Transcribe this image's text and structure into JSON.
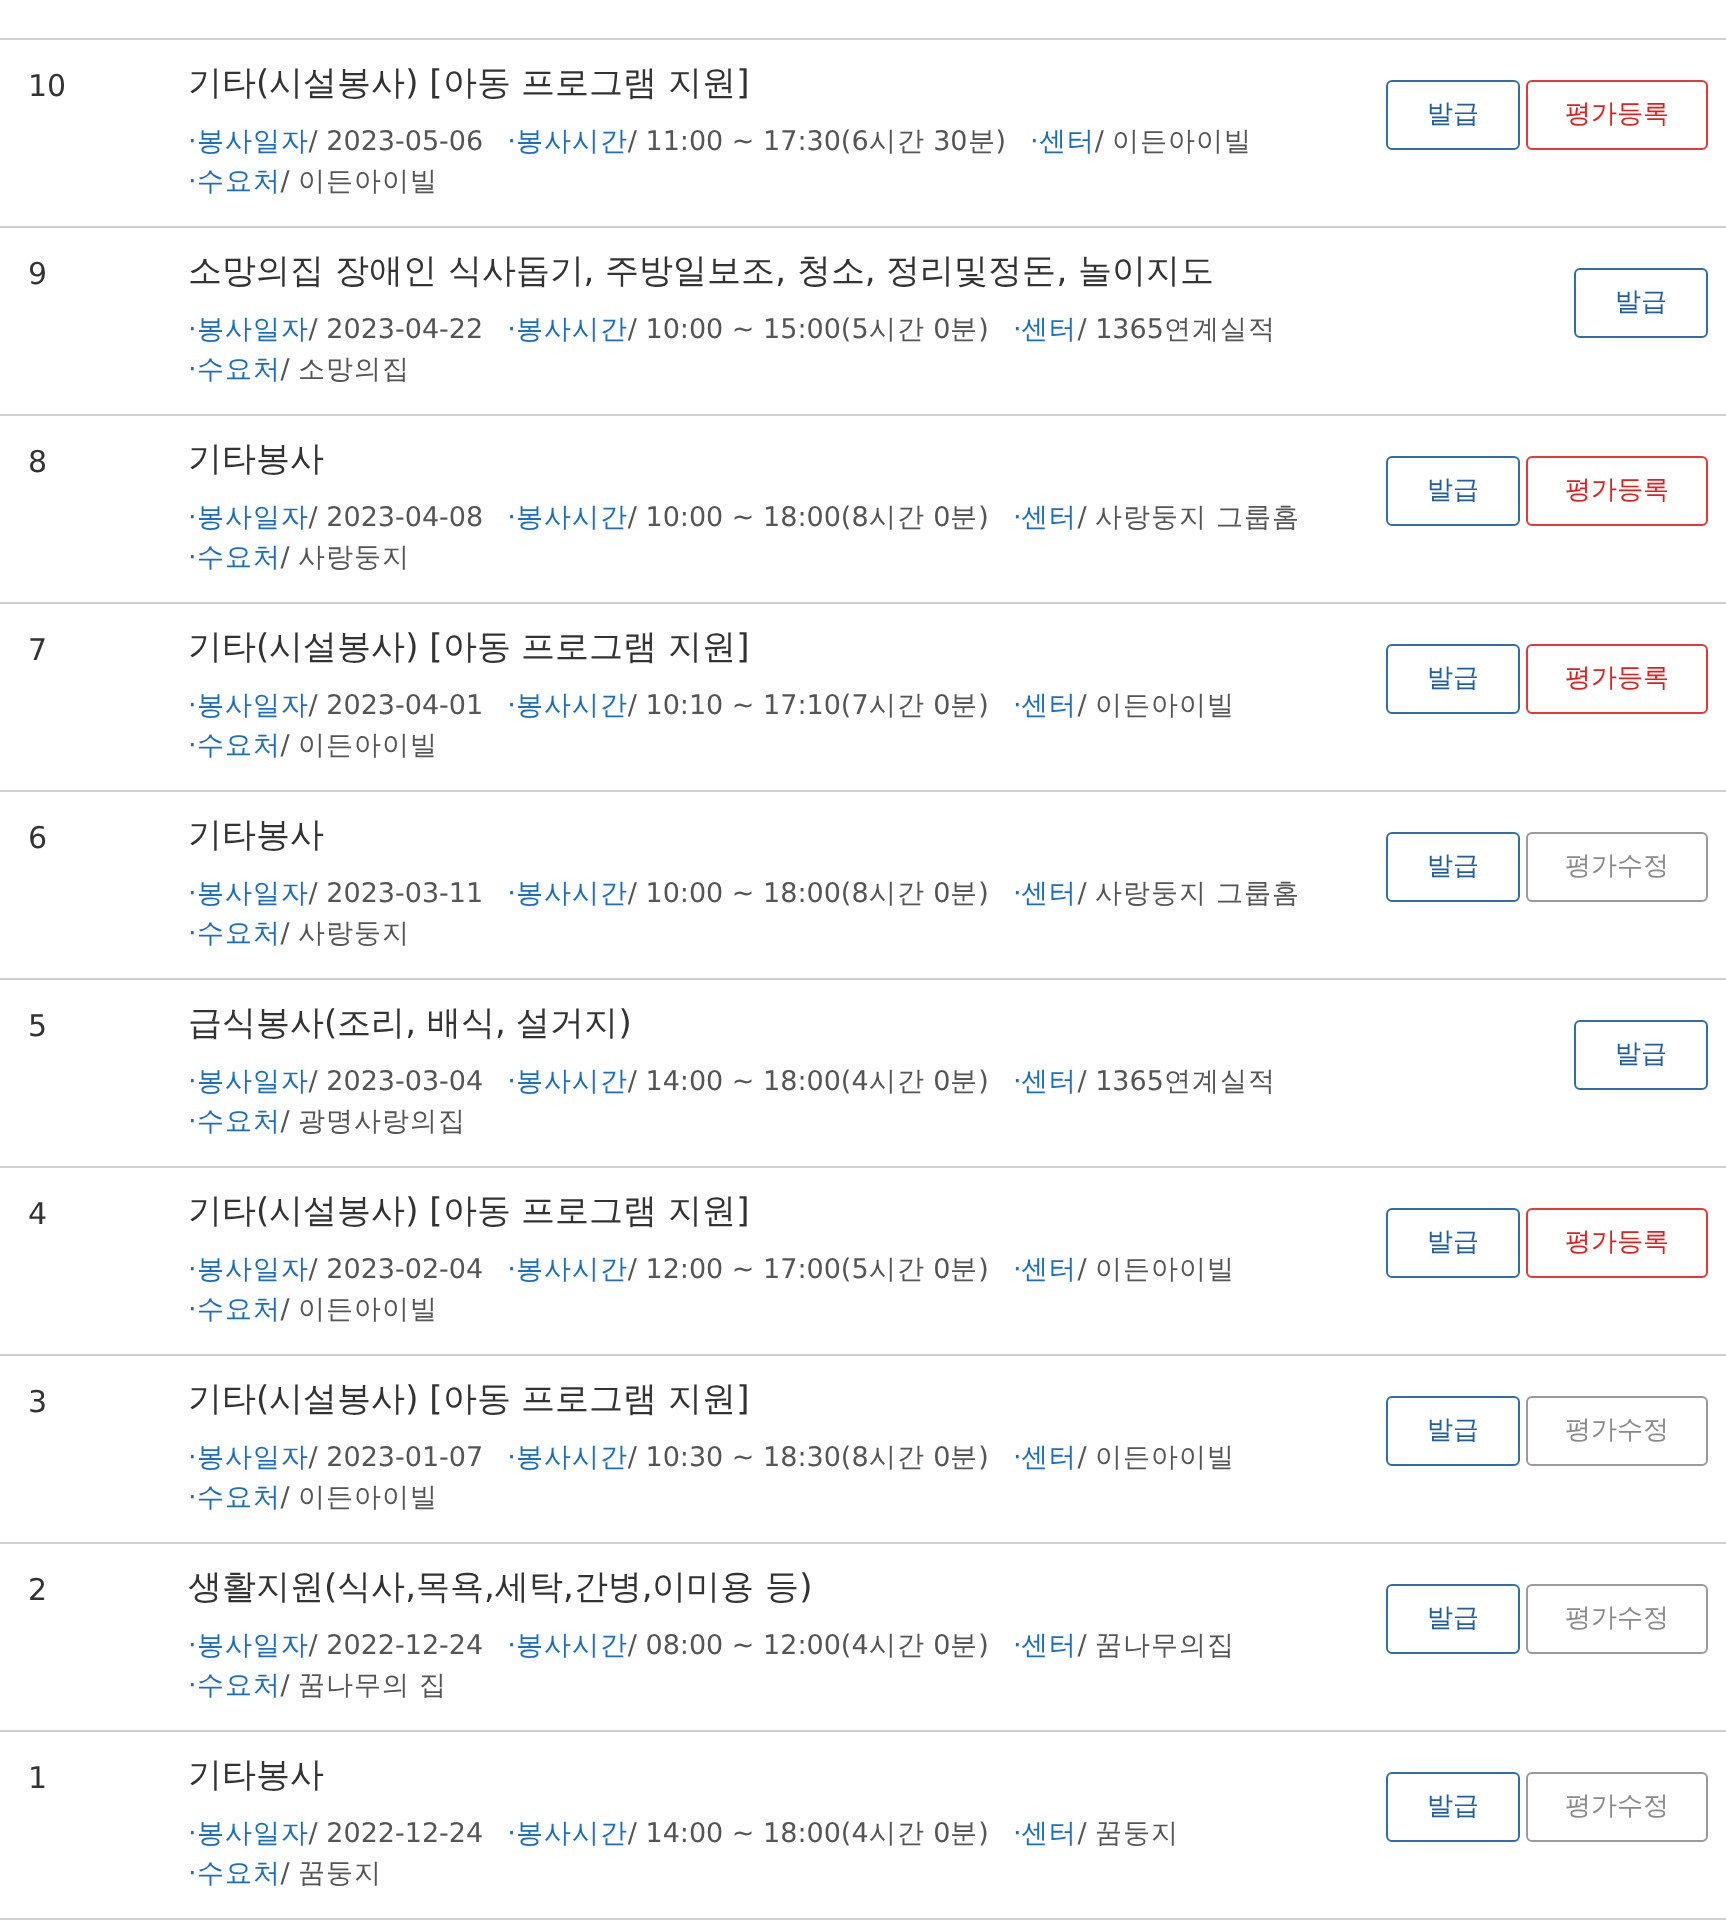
{
  "rows": [
    {
      "no": "10",
      "title": "기타(시설봉사)  [아동 프로그램 지원]",
      "lines": [
        [
          {
            "label": "·봉사일자",
            "value": "/ 2023-05-06"
          },
          {
            "label": "·봉사시간",
            "value": "/ 11:00 ~ 17:30(6시간 30분)"
          },
          {
            "label": "·센터",
            "value": "/ 이든아이빌"
          }
        ],
        [
          {
            "label": "·수요처",
            "value": "/ 이든아이빌"
          }
        ]
      ],
      "buttons": [
        {
          "kind": "issue",
          "label": "발급"
        },
        {
          "kind": "register",
          "label": "평가등록"
        }
      ]
    },
    {
      "no": "9",
      "title": "소망의집 장애인 식사돕기, 주방일보조, 청소, 정리및정돈, 놀이지도",
      "lines": [
        [
          {
            "label": "·봉사일자",
            "value": "/ 2023-04-22"
          },
          {
            "label": "·봉사시간",
            "value": "/ 10:00 ~ 15:00(5시간 0분)"
          },
          {
            "label": "·센터",
            "value": "/ 1365연계실적"
          }
        ],
        [
          {
            "label": "·수요처",
            "value": "/ 소망의집"
          }
        ]
      ],
      "buttons": [
        {
          "kind": "issue",
          "label": "발급"
        }
      ]
    },
    {
      "no": "8",
      "title": "기타봉사",
      "lines": [
        [
          {
            "label": "·봉사일자",
            "value": "/ 2023-04-08"
          },
          {
            "label": "·봉사시간",
            "value": "/ 10:00 ~ 18:00(8시간 0분)"
          },
          {
            "label": "·센터",
            "value": "/ 사랑둥지 그룹홈"
          }
        ],
        [
          {
            "label": "·수요처",
            "value": "/ 사랑둥지"
          }
        ]
      ],
      "buttons": [
        {
          "kind": "issue",
          "label": "발급"
        },
        {
          "kind": "register",
          "label": "평가등록"
        }
      ]
    },
    {
      "no": "7",
      "title": "기타(시설봉사)  [아동 프로그램 지원]",
      "lines": [
        [
          {
            "label": "·봉사일자",
            "value": "/ 2023-04-01"
          },
          {
            "label": "·봉사시간",
            "value": "/ 10:10 ~ 17:10(7시간 0분)"
          },
          {
            "label": "·센터",
            "value": "/ 이든아이빌"
          }
        ],
        [
          {
            "label": "·수요처",
            "value": "/ 이든아이빌"
          }
        ]
      ],
      "buttons": [
        {
          "kind": "issue",
          "label": "발급"
        },
        {
          "kind": "register",
          "label": "평가등록"
        }
      ]
    },
    {
      "no": "6",
      "title": "기타봉사",
      "lines": [
        [
          {
            "label": "·봉사일자",
            "value": "/ 2023-03-11"
          },
          {
            "label": "·봉사시간",
            "value": "/ 10:00 ~ 18:00(8시간 0분)"
          },
          {
            "label": "·센터",
            "value": "/ 사랑둥지 그룹홈"
          }
        ],
        [
          {
            "label": "·수요처",
            "value": "/ 사랑둥지"
          }
        ]
      ],
      "buttons": [
        {
          "kind": "issue",
          "label": "발급"
        },
        {
          "kind": "edit",
          "label": "평가수정"
        }
      ]
    },
    {
      "no": "5",
      "title": "급식봉사(조리, 배식, 설거지)",
      "lines": [
        [
          {
            "label": "·봉사일자",
            "value": "/ 2023-03-04"
          },
          {
            "label": "·봉사시간",
            "value": "/ 14:00 ~ 18:00(4시간 0분)"
          },
          {
            "label": "·센터",
            "value": "/ 1365연계실적"
          }
        ],
        [
          {
            "label": "·수요처",
            "value": "/ 광명사랑의집"
          }
        ]
      ],
      "buttons": [
        {
          "kind": "issue",
          "label": "발급"
        }
      ]
    },
    {
      "no": "4",
      "title": "기타(시설봉사)  [아동 프로그램 지원]",
      "lines": [
        [
          {
            "label": "·봉사일자",
            "value": "/ 2023-02-04"
          },
          {
            "label": "·봉사시간",
            "value": "/ 12:00 ~ 17:00(5시간 0분)"
          },
          {
            "label": "·센터",
            "value": "/ 이든아이빌"
          }
        ],
        [
          {
            "label": "·수요처",
            "value": "/ 이든아이빌"
          }
        ]
      ],
      "buttons": [
        {
          "kind": "issue",
          "label": "발급"
        },
        {
          "kind": "register",
          "label": "평가등록"
        }
      ]
    },
    {
      "no": "3",
      "title": "기타(시설봉사)  [아동 프로그램 지원]",
      "lines": [
        [
          {
            "label": "·봉사일자",
            "value": "/ 2023-01-07"
          },
          {
            "label": "·봉사시간",
            "value": "/ 10:30 ~ 18:30(8시간 0분)"
          },
          {
            "label": "·센터",
            "value": "/ 이든아이빌"
          }
        ],
        [
          {
            "label": "·수요처",
            "value": "/ 이든아이빌"
          }
        ]
      ],
      "buttons": [
        {
          "kind": "issue",
          "label": "발급"
        },
        {
          "kind": "edit",
          "label": "평가수정"
        }
      ]
    },
    {
      "no": "2",
      "title": "생활지원(식사,목욕,세탁,간병,이미용 등)",
      "lines": [
        [
          {
            "label": "·봉사일자",
            "value": "/ 2022-12-24"
          },
          {
            "label": "·봉사시간",
            "value": "/ 08:00 ~ 12:00(4시간 0분)"
          },
          {
            "label": "·센터",
            "value": "/ 꿈나무의집"
          }
        ],
        [
          {
            "label": "·수요처",
            "value": "/ 꿈나무의 집"
          }
        ]
      ],
      "buttons": [
        {
          "kind": "issue",
          "label": "발급"
        },
        {
          "kind": "edit",
          "label": "평가수정"
        }
      ]
    },
    {
      "no": "1",
      "title": "기타봉사",
      "lines": [
        [
          {
            "label": "·봉사일자",
            "value": "/ 2022-12-24"
          },
          {
            "label": "·봉사시간",
            "value": "/ 14:00 ~ 18:00(4시간 0분)"
          },
          {
            "label": "·센터",
            "value": "/ 꿈둥지"
          }
        ],
        [
          {
            "label": "·수요처",
            "value": "/ 꿈둥지"
          }
        ]
      ],
      "buttons": [
        {
          "kind": "issue",
          "label": "발급"
        },
        {
          "kind": "edit",
          "label": "평가수정"
        }
      ]
    }
  ]
}
